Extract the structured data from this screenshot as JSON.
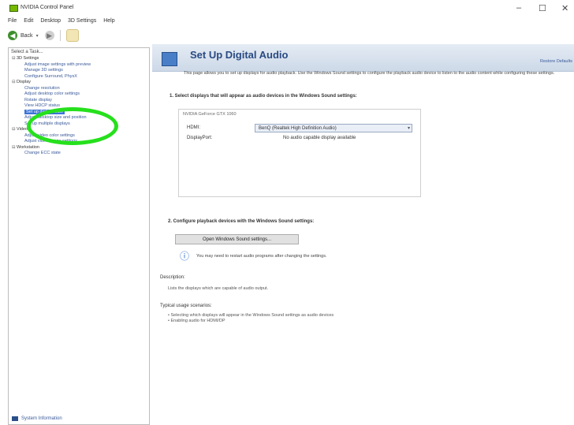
{
  "window": {
    "title": "NVIDIA Control Panel",
    "controls": [
      "–",
      "☐",
      "✕"
    ]
  },
  "menu": [
    "File",
    "Edit",
    "Desktop",
    "3D Settings",
    "Help"
  ],
  "toolbar": {
    "back_label": "Back",
    "back_glyph": "◀",
    "forward_glyph": "▶",
    "drop_glyph": "▾"
  },
  "left": {
    "header": "Select a Task...",
    "tree": [
      {
        "label": "3D Settings",
        "level": 0,
        "type": "cat",
        "toggle": "⊟"
      },
      {
        "label": "Adjust image settings with preview",
        "level": 1
      },
      {
        "label": "Manage 3D settings",
        "level": 1
      },
      {
        "label": "Configure Surround, PhysX",
        "level": 1
      },
      {
        "label": "Display",
        "level": 0,
        "type": "cat",
        "toggle": "⊟"
      },
      {
        "label": "Change resolution",
        "level": 1
      },
      {
        "label": "Adjust desktop color settings",
        "level": 1
      },
      {
        "label": "Rotate display",
        "level": 1
      },
      {
        "label": "View HDCP status",
        "level": 1
      },
      {
        "label": "Set up digital audio",
        "level": 1,
        "selected": true
      },
      {
        "label": "Adjust desktop size and position",
        "level": 1
      },
      {
        "label": "Set up multiple displays",
        "level": 1
      },
      {
        "label": "Video",
        "level": 0,
        "type": "cat",
        "toggle": "⊟"
      },
      {
        "label": "Adjust video color settings",
        "level": 1
      },
      {
        "label": "Adjust video image settings",
        "level": 1
      },
      {
        "label": "Workstation",
        "level": 0,
        "type": "cat",
        "toggle": "⊟"
      },
      {
        "label": "Change ECC state",
        "level": 1
      }
    ],
    "system_info": "System Information"
  },
  "banner": {
    "title": "Set Up Digital Audio",
    "restore": "Restore Defaults"
  },
  "content": {
    "intro": "This page allows you to set up displays for audio playback. Use the Windows Sound settings to configure the playback audio device to listen to the audio content while configuring these settings.",
    "section1_title": "1. Select displays that will appear as audio devices in the Windows Sound settings:",
    "group_legend": "NVIDIA GeForce GTX 1060",
    "row1_label": "HDMI:",
    "row1_value": "BenQ (Realtek High Definition Audio)",
    "row2_label": "DisplayPort:",
    "row2_value": "No audio capable display available",
    "select_arrow": "▾",
    "section2_title": "2. Configure playback devices with the Windows Sound settings:",
    "sound_button": "Open Windows Sound settings...",
    "info_glyph": "ⓘ",
    "info_text": "You may need to restart audio programs after changing the settings.",
    "description_label": "Description:",
    "description_text": "Lists the displays which are capable of audio output.",
    "usage_label": "Typical usage scenarios:",
    "usage_items": [
      "Selecting which displays will appear in the Windows Sound settings as audio devices",
      "Enabling audio for HDMI/DP"
    ]
  },
  "colors": {
    "accent_green": "#26e01c",
    "banner_title": "#2a4a82",
    "selection": "#3a73d6"
  }
}
